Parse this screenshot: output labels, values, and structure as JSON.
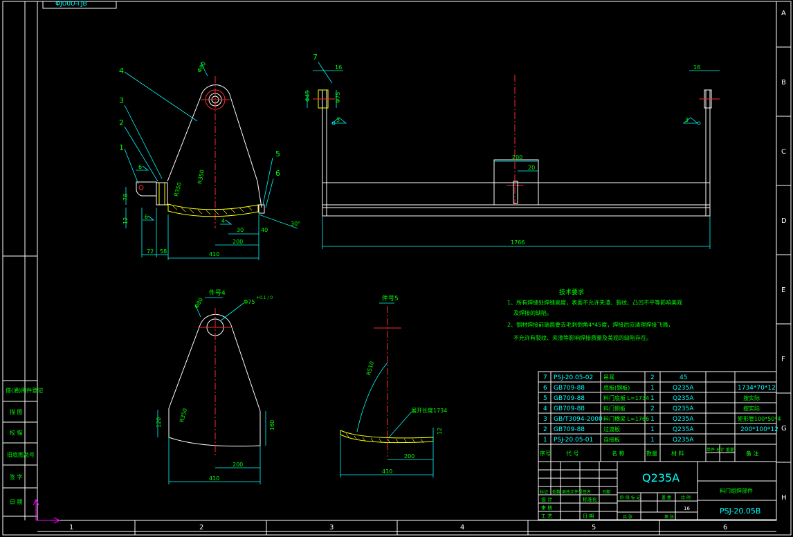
{
  "colors": {
    "background": "#000000",
    "frame": "#ffffff",
    "dimension": "#00ffff",
    "centerline": "#ff2a2a",
    "text": "#00ff00",
    "weld": "#ffff00"
  },
  "frame_cut_text": "ΦJU0U-ΓJB",
  "column_numbers": [
    "1",
    "2",
    "3",
    "4",
    "5",
    "6"
  ],
  "row_letters": [
    "A",
    "B",
    "C",
    "D",
    "E",
    "F",
    "G",
    "H"
  ],
  "side_labels": [
    "借(通)用件登记",
    "描 图",
    "校 描",
    "旧底图总号",
    "签 字",
    "日 期"
  ],
  "view1": {
    "callouts": [
      "4",
      "3",
      "2",
      "1",
      "5",
      "6",
      "7"
    ],
    "dims": {
      "d180": "Φ80",
      "r350": "R350",
      "r350b": "R350",
      "d78": "78",
      "d12": "12",
      "d72": "72",
      "d58": "58",
      "d410": "410",
      "d200": "200",
      "d30": "30",
      "d40": "40",
      "ang30": "30°"
    },
    "weld_marks": [
      "6",
      "6",
      "4"
    ]
  },
  "view2": {
    "dims": {
      "d16a": "16",
      "d16b": "16",
      "d45": "Φ45",
      "d75": "Φ75",
      "d200": "200",
      "d20": "20",
      "d1766": "1766",
      "w3a": "3",
      "w3b": "3"
    }
  },
  "view3": {
    "title": "件号4",
    "dims": {
      "d80": "Φ80",
      "d75": "Φ75",
      "tol": "+0.1 / 0",
      "r350": "R350",
      "d120": "120",
      "d160": "160",
      "d200": "200",
      "d410": "410"
    }
  },
  "view4": {
    "title": "件号5",
    "dims": {
      "r510": "R510",
      "note": "展开长度1734",
      "d12": "12",
      "d200": "200",
      "d410": "410"
    }
  },
  "tech": {
    "title": "技术要求",
    "lines": [
      "1、所有焊缝处焊缝高度，表面不允许夹渣、裂纹、凸凹不平等影响美观",
      "及焊接的缺陷。",
      "2、钢材焊接前端面要去毛刺倒角4*45度，焊接后应清理焊接飞溅，",
      "不允许有裂纹、夹渣等影响焊接质量及美观的缺陷存在。"
    ]
  },
  "bom": {
    "rows": [
      {
        "no": "7",
        "code": "PSJ-20.05-02",
        "name": "吊耳",
        "qty": "2",
        "mat": "45",
        "note": ""
      },
      {
        "no": "6",
        "code": "GB709-88",
        "name": "底板(钢板)",
        "qty": "1",
        "mat": "Q235A",
        "note": "1734*70*12"
      },
      {
        "no": "5",
        "code": "GB709-88",
        "name": "料门底板 L=1734",
        "qty": "1",
        "mat": "Q235A",
        "note": "按实际"
      },
      {
        "no": "4",
        "code": "GB709-88",
        "name": "料门侧板",
        "qty": "2",
        "mat": "Q235A",
        "note": "按实际"
      },
      {
        "no": "3",
        "code": "GB/T3094-2000",
        "name": "料门横梁 L=1766",
        "qty": "1",
        "mat": "Q235A",
        "note": "矩形管100*50*4"
      },
      {
        "no": "2",
        "code": "GB709-88",
        "name": "过渡板",
        "qty": "1",
        "mat": "Q235A",
        "note": "200*100*12"
      },
      {
        "no": "1",
        "code": "PSJ-20.05-01",
        "name": "连接板",
        "qty": "1",
        "mat": "Q235A",
        "note": ""
      }
    ],
    "headers": [
      "序号",
      "代 号",
      "名 称",
      "数量",
      "材 料",
      "单件 总计 重量",
      "备 注"
    ]
  },
  "title_block": {
    "material": "Q235A",
    "part_name": "料门组焊部件",
    "drawing_no": "PSJ-20.05B",
    "scale_label": "比例",
    "qty_value": "16",
    "labels": [
      "标记",
      "处数",
      "更改文件号",
      "签名",
      "日期",
      "设 计",
      "标准化",
      "审 核",
      "工 艺",
      "日 期",
      "阶 段 标 记",
      "重 量",
      "比 例",
      "共 张",
      "第 张"
    ]
  }
}
